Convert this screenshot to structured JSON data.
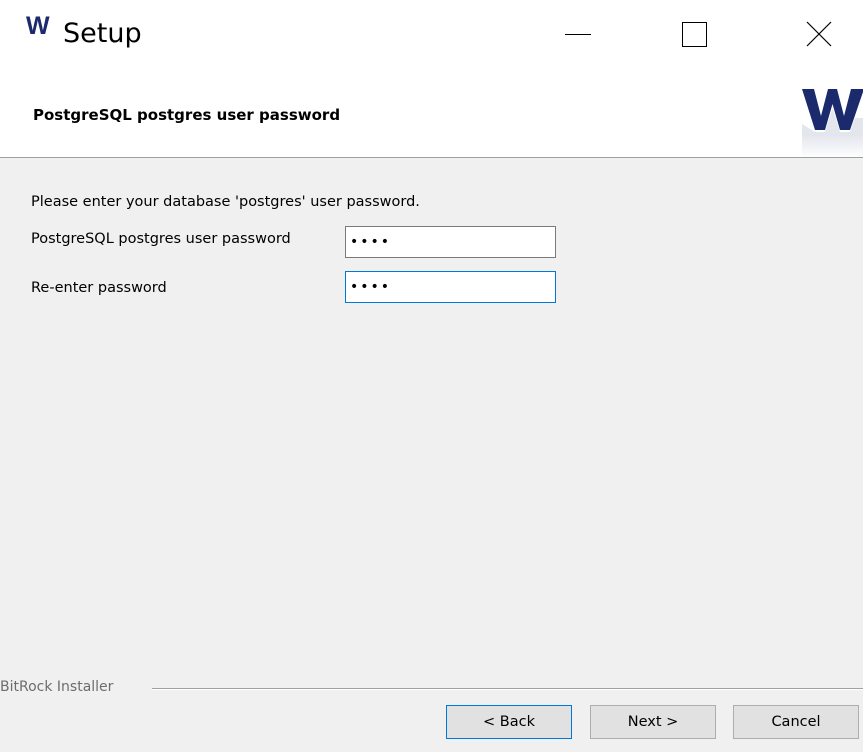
{
  "window": {
    "title": "Setup",
    "app_icon_letter": "W",
    "controls": {
      "minimize": "minimize",
      "maximize": "maximize",
      "close": "close"
    }
  },
  "header": {
    "title": "PostgreSQL postgres user password",
    "logo_letter": "W"
  },
  "form": {
    "instruction": "Please enter your database 'postgres' user password.",
    "password_label": "PostgreSQL postgres user password",
    "password_value": "••••",
    "reenter_label": "Re-enter password",
    "reenter_value": "••••"
  },
  "footer": {
    "brand": "BitRock Installer",
    "back_label": "< Back",
    "next_label": "Next >",
    "cancel_label": "Cancel"
  },
  "colors": {
    "accent": "#0078d7",
    "brand": "#1a2a6c",
    "background": "#f0f0f0"
  }
}
